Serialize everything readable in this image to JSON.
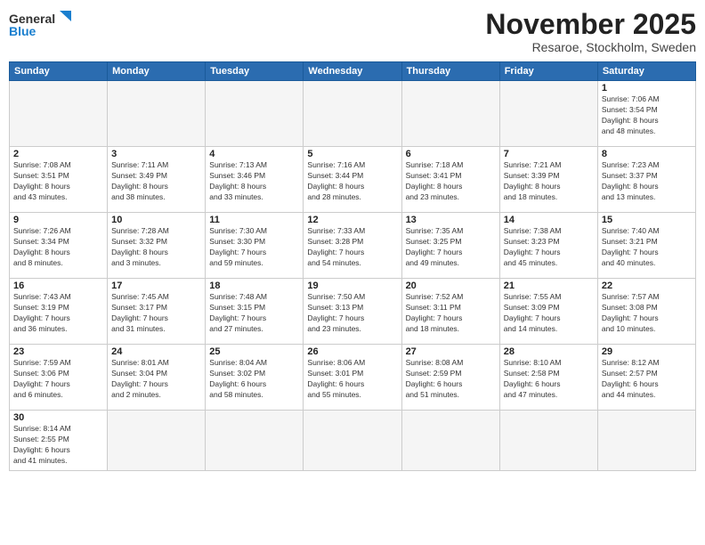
{
  "logo": {
    "general": "General",
    "blue": "Blue"
  },
  "title": "November 2025",
  "location": "Resaroe, Stockholm, Sweden",
  "weekdays": [
    "Sunday",
    "Monday",
    "Tuesday",
    "Wednesday",
    "Thursday",
    "Friday",
    "Saturday"
  ],
  "weeks": [
    [
      {
        "day": null,
        "info": null
      },
      {
        "day": null,
        "info": null
      },
      {
        "day": null,
        "info": null
      },
      {
        "day": null,
        "info": null
      },
      {
        "day": null,
        "info": null
      },
      {
        "day": null,
        "info": null
      },
      {
        "day": "1",
        "info": "Sunrise: 7:06 AM\nSunset: 3:54 PM\nDaylight: 8 hours\nand 48 minutes."
      }
    ],
    [
      {
        "day": "2",
        "info": "Sunrise: 7:08 AM\nSunset: 3:51 PM\nDaylight: 8 hours\nand 43 minutes."
      },
      {
        "day": "3",
        "info": "Sunrise: 7:11 AM\nSunset: 3:49 PM\nDaylight: 8 hours\nand 38 minutes."
      },
      {
        "day": "4",
        "info": "Sunrise: 7:13 AM\nSunset: 3:46 PM\nDaylight: 8 hours\nand 33 minutes."
      },
      {
        "day": "5",
        "info": "Sunrise: 7:16 AM\nSunset: 3:44 PM\nDaylight: 8 hours\nand 28 minutes."
      },
      {
        "day": "6",
        "info": "Sunrise: 7:18 AM\nSunset: 3:41 PM\nDaylight: 8 hours\nand 23 minutes."
      },
      {
        "day": "7",
        "info": "Sunrise: 7:21 AM\nSunset: 3:39 PM\nDaylight: 8 hours\nand 18 minutes."
      },
      {
        "day": "8",
        "info": "Sunrise: 7:23 AM\nSunset: 3:37 PM\nDaylight: 8 hours\nand 13 minutes."
      }
    ],
    [
      {
        "day": "9",
        "info": "Sunrise: 7:26 AM\nSunset: 3:34 PM\nDaylight: 8 hours\nand 8 minutes."
      },
      {
        "day": "10",
        "info": "Sunrise: 7:28 AM\nSunset: 3:32 PM\nDaylight: 8 hours\nand 3 minutes."
      },
      {
        "day": "11",
        "info": "Sunrise: 7:30 AM\nSunset: 3:30 PM\nDaylight: 7 hours\nand 59 minutes."
      },
      {
        "day": "12",
        "info": "Sunrise: 7:33 AM\nSunset: 3:28 PM\nDaylight: 7 hours\nand 54 minutes."
      },
      {
        "day": "13",
        "info": "Sunrise: 7:35 AM\nSunset: 3:25 PM\nDaylight: 7 hours\nand 49 minutes."
      },
      {
        "day": "14",
        "info": "Sunrise: 7:38 AM\nSunset: 3:23 PM\nDaylight: 7 hours\nand 45 minutes."
      },
      {
        "day": "15",
        "info": "Sunrise: 7:40 AM\nSunset: 3:21 PM\nDaylight: 7 hours\nand 40 minutes."
      }
    ],
    [
      {
        "day": "16",
        "info": "Sunrise: 7:43 AM\nSunset: 3:19 PM\nDaylight: 7 hours\nand 36 minutes."
      },
      {
        "day": "17",
        "info": "Sunrise: 7:45 AM\nSunset: 3:17 PM\nDaylight: 7 hours\nand 31 minutes."
      },
      {
        "day": "18",
        "info": "Sunrise: 7:48 AM\nSunset: 3:15 PM\nDaylight: 7 hours\nand 27 minutes."
      },
      {
        "day": "19",
        "info": "Sunrise: 7:50 AM\nSunset: 3:13 PM\nDaylight: 7 hours\nand 23 minutes."
      },
      {
        "day": "20",
        "info": "Sunrise: 7:52 AM\nSunset: 3:11 PM\nDaylight: 7 hours\nand 18 minutes."
      },
      {
        "day": "21",
        "info": "Sunrise: 7:55 AM\nSunset: 3:09 PM\nDaylight: 7 hours\nand 14 minutes."
      },
      {
        "day": "22",
        "info": "Sunrise: 7:57 AM\nSunset: 3:08 PM\nDaylight: 7 hours\nand 10 minutes."
      }
    ],
    [
      {
        "day": "23",
        "info": "Sunrise: 7:59 AM\nSunset: 3:06 PM\nDaylight: 7 hours\nand 6 minutes."
      },
      {
        "day": "24",
        "info": "Sunrise: 8:01 AM\nSunset: 3:04 PM\nDaylight: 7 hours\nand 2 minutes."
      },
      {
        "day": "25",
        "info": "Sunrise: 8:04 AM\nSunset: 3:02 PM\nDaylight: 6 hours\nand 58 minutes."
      },
      {
        "day": "26",
        "info": "Sunrise: 8:06 AM\nSunset: 3:01 PM\nDaylight: 6 hours\nand 55 minutes."
      },
      {
        "day": "27",
        "info": "Sunrise: 8:08 AM\nSunset: 2:59 PM\nDaylight: 6 hours\nand 51 minutes."
      },
      {
        "day": "28",
        "info": "Sunrise: 8:10 AM\nSunset: 2:58 PM\nDaylight: 6 hours\nand 47 minutes."
      },
      {
        "day": "29",
        "info": "Sunrise: 8:12 AM\nSunset: 2:57 PM\nDaylight: 6 hours\nand 44 minutes."
      }
    ],
    [
      {
        "day": "30",
        "info": "Sunrise: 8:14 AM\nSunset: 2:55 PM\nDaylight: 6 hours\nand 41 minutes."
      },
      {
        "day": null,
        "info": null
      },
      {
        "day": null,
        "info": null
      },
      {
        "day": null,
        "info": null
      },
      {
        "day": null,
        "info": null
      },
      {
        "day": null,
        "info": null
      },
      {
        "day": null,
        "info": null
      }
    ]
  ]
}
